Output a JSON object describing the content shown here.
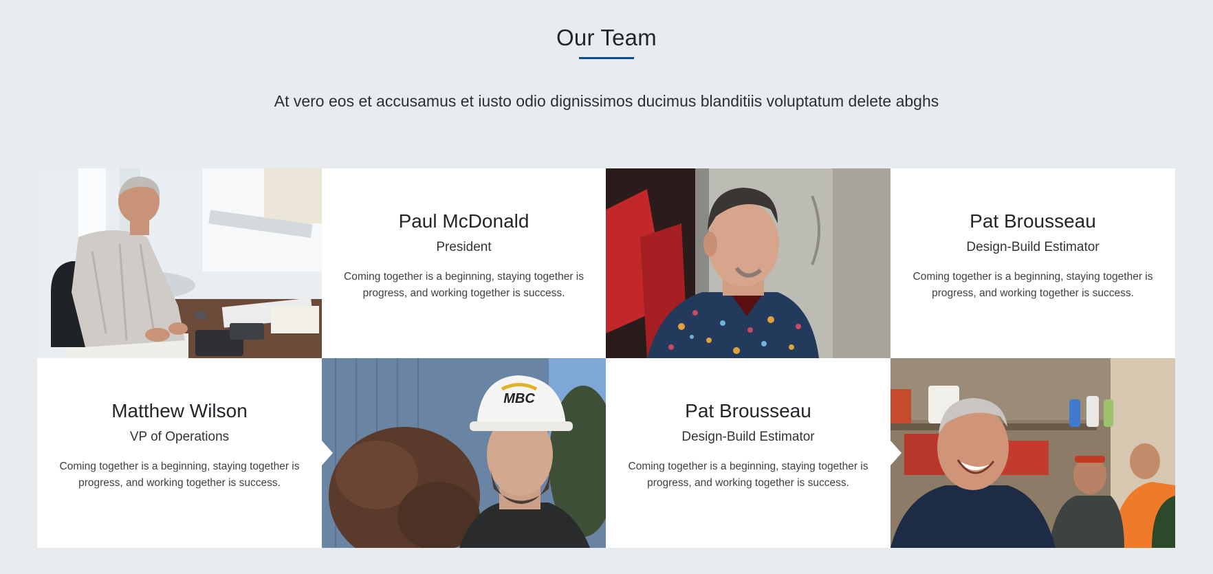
{
  "section": {
    "title": "Our Team",
    "subtitle": "At vero eos et accusamus et iusto odio dignissimos ducimus blanditiis voluptatum delete abghs"
  },
  "accent_color": "#0b4b9b",
  "members": [
    {
      "name": "Paul McDonald",
      "role": "President",
      "quote": "Coming together is a beginning, staying together is progress, and working together is success."
    },
    {
      "name": "Pat Brousseau",
      "role": "Design-Build Estimator",
      "quote": "Coming together is a beginning, staying together is progress, and working together is success."
    },
    {
      "name": "Matthew Wilson",
      "role": "VP of Operations",
      "quote": "Coming together is a beginning, staying together is progress, and working together is success."
    },
    {
      "name": "Pat Brousseau",
      "role": "Design-Build Estimator",
      "quote": "Coming together is a beginning, staying together is progress, and working together is success."
    }
  ],
  "hardhat_logo_text": "MBC"
}
